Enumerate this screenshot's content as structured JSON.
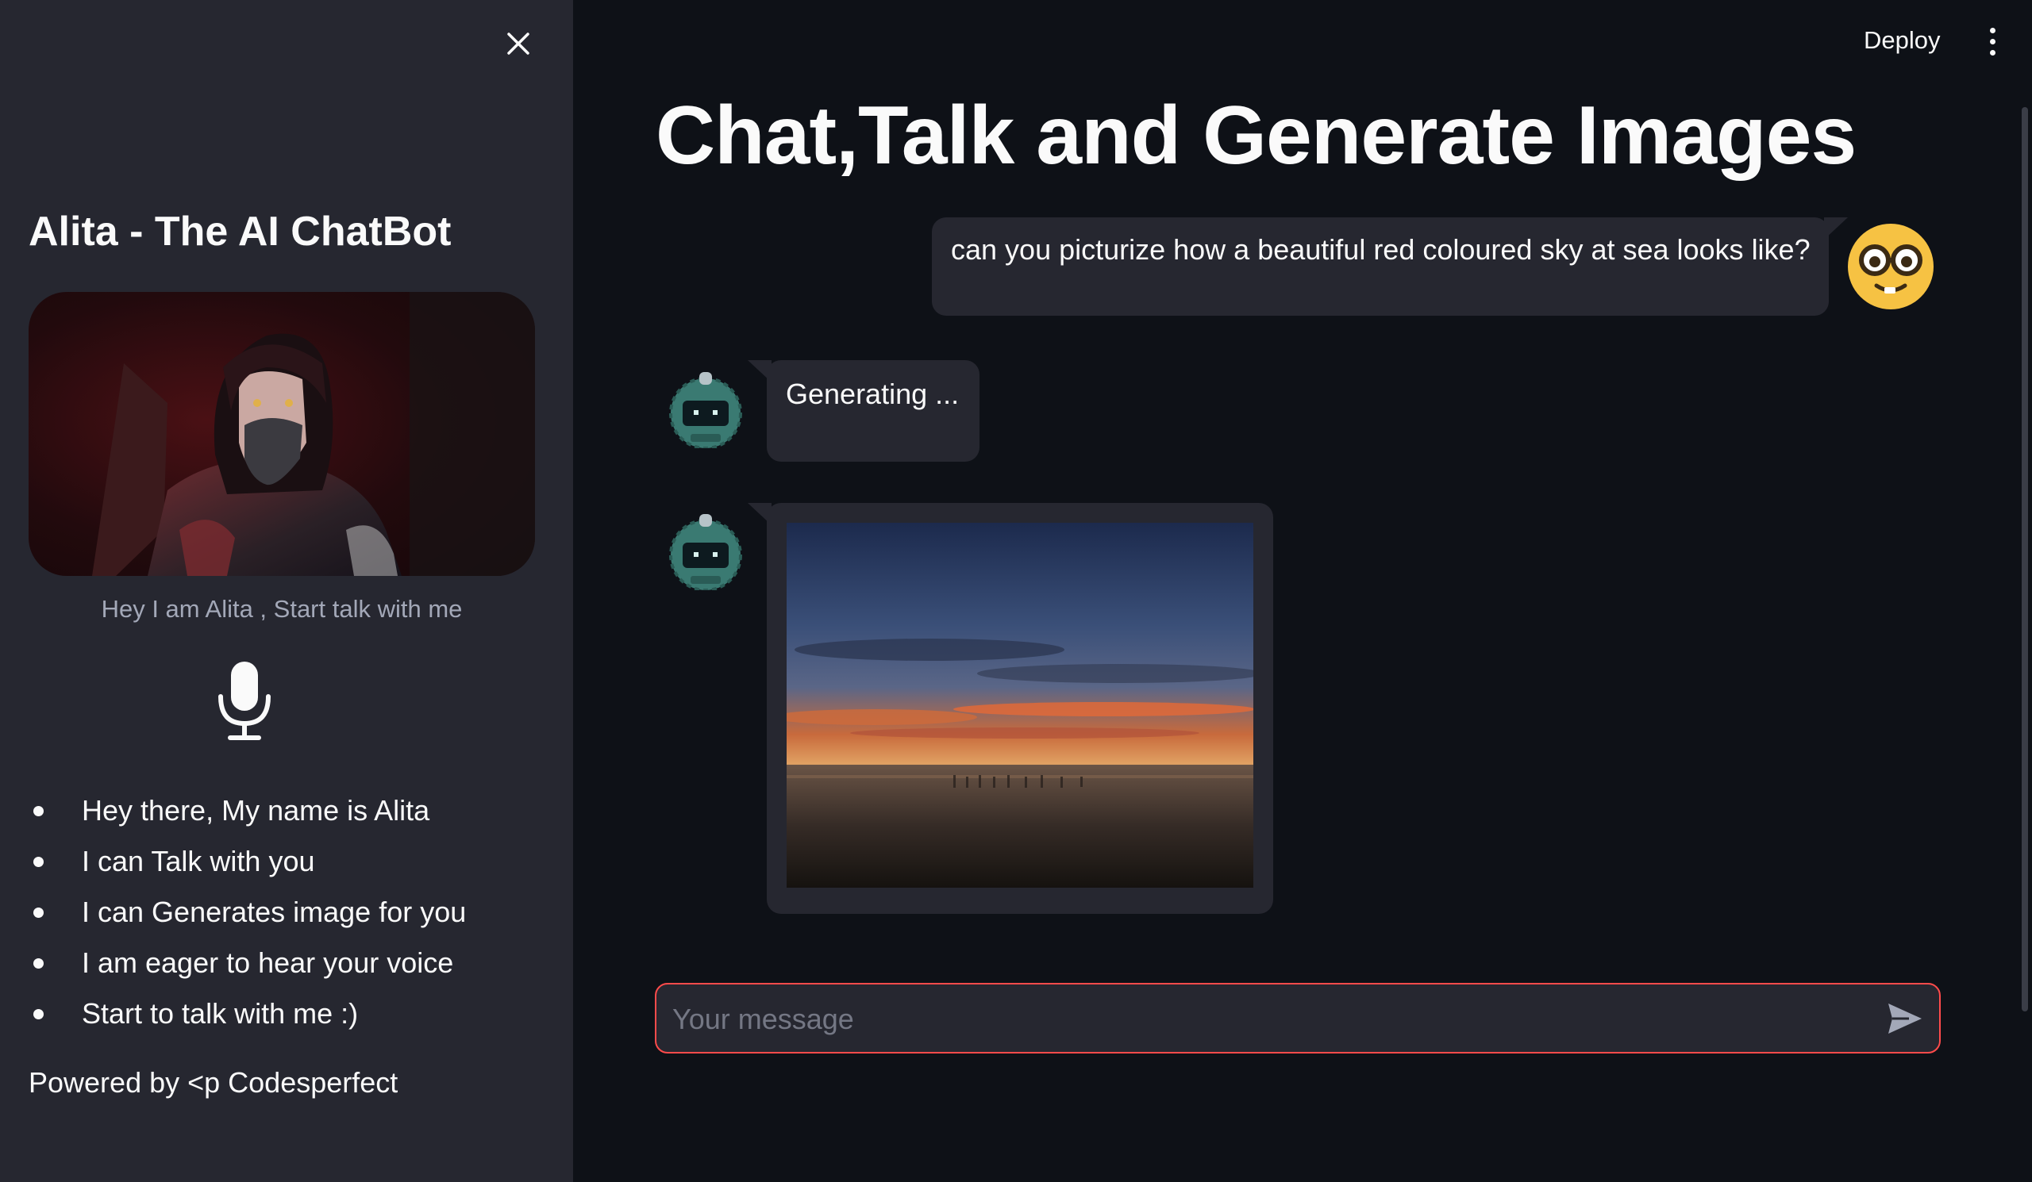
{
  "sidebar": {
    "title": "Alita - The AI ChatBot",
    "caption": "Hey I am Alita , Start talk with me",
    "features": [
      "Hey there, My name is Alita",
      "I can Talk with you",
      "I can Generates image for you",
      "I am eager to hear your voice",
      "Start to talk with me :)"
    ],
    "powered_by": "Powered by <p Codesperfect",
    "icons": {
      "close": "close-icon",
      "mic": "microphone-icon"
    }
  },
  "header": {
    "deploy_label": "Deploy",
    "menu_icon": "vertical-dots-icon"
  },
  "main": {
    "title": "Chat,Talk and Generate Images",
    "messages": [
      {
        "role": "user",
        "text": "can you picturize how a beautiful red coloured sky at sea looks like?"
      },
      {
        "role": "assistant",
        "text": "Generating ..."
      },
      {
        "role": "assistant",
        "image": "red-sky-at-sea-sunset"
      }
    ],
    "input": {
      "placeholder": "Your message",
      "value": ""
    },
    "send_icon": "send-icon"
  },
  "colors": {
    "main_bg": "#0e1117",
    "sidebar_bg": "#262730",
    "bubble_bg": "#262730",
    "accent": "#ff4b4b",
    "text": "#fafafa"
  }
}
